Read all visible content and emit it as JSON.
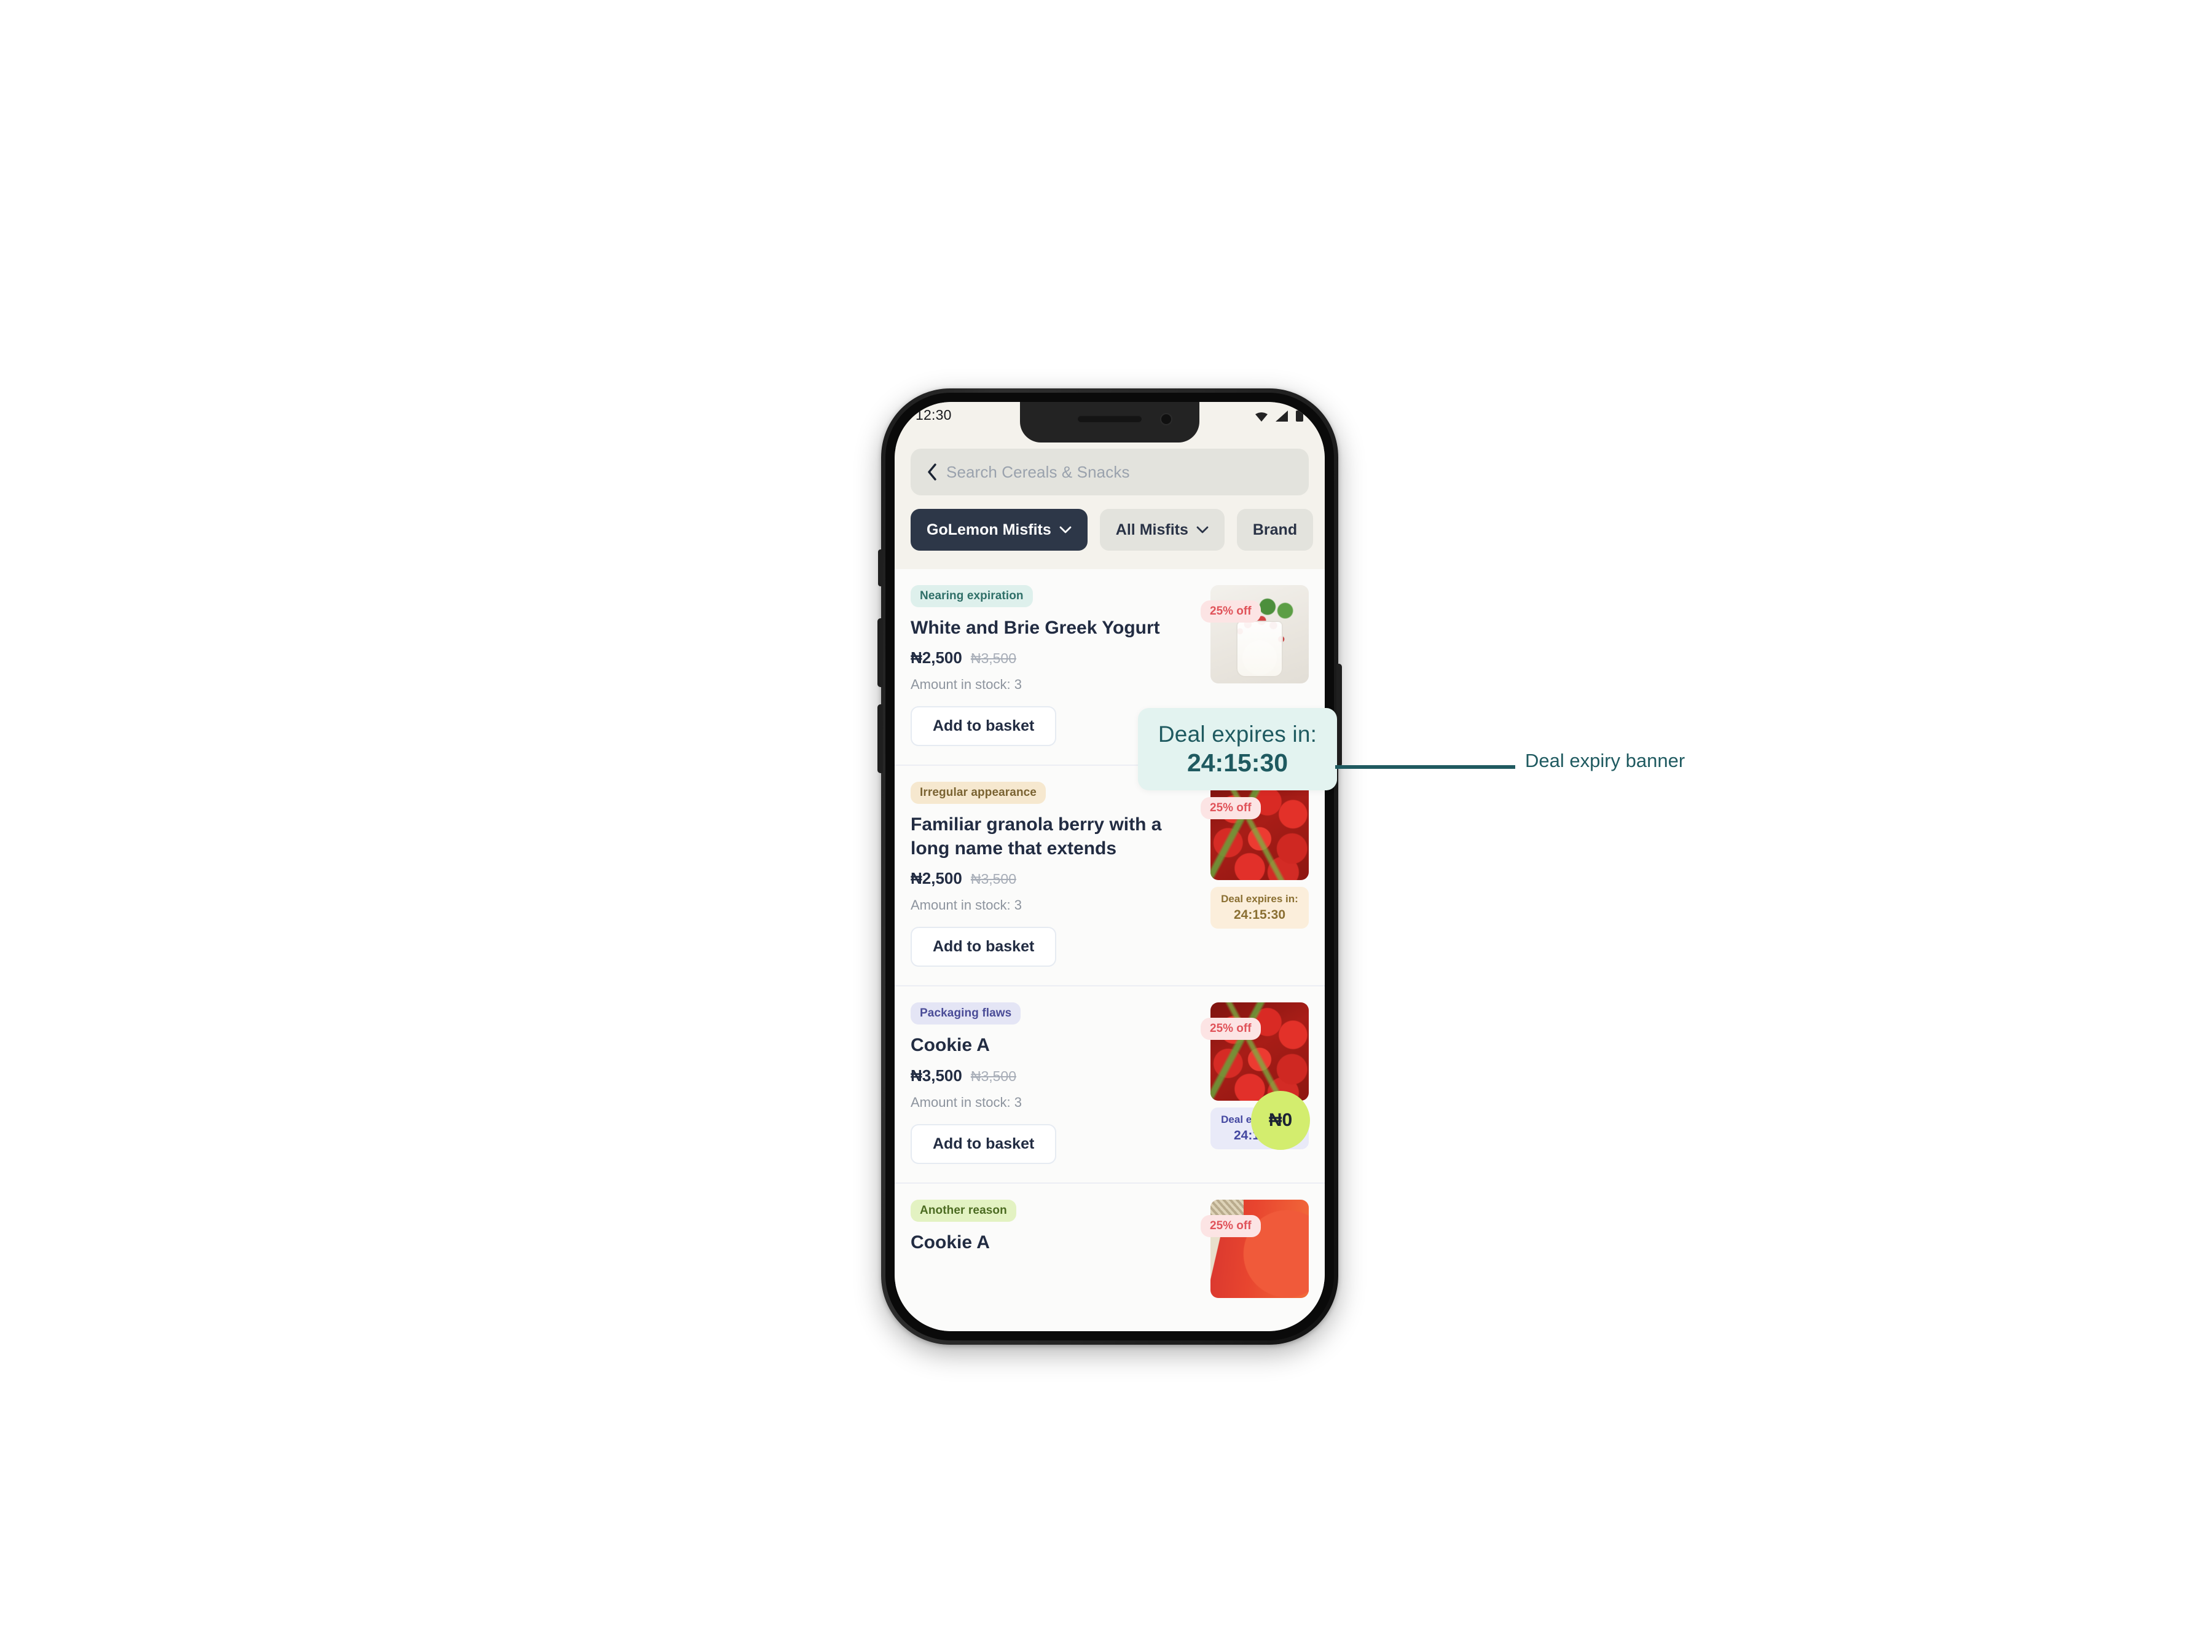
{
  "phone": {
    "status_bar": {
      "clock": "12:30",
      "icons": [
        "wifi-icon",
        "cellular-signal-icon",
        "battery-icon"
      ]
    }
  },
  "search": {
    "back_icon": "chevron-left-icon",
    "placeholder": "Search Cereals & Snacks",
    "value": ""
  },
  "filters": [
    {
      "label": "GoLemon Misfits",
      "active": true,
      "icon": "chevron-down-icon"
    },
    {
      "label": "All Misfits",
      "active": false,
      "icon": "chevron-down-icon"
    },
    {
      "label": "Brand",
      "active": false,
      "icon": "chevron-down-icon"
    }
  ],
  "products": [
    {
      "tag": "Nearing expiration",
      "tag_style": "mint",
      "name": "White and Brie Greek Yogurt",
      "price_now": "₦2,500",
      "price_old": "₦3,500",
      "stock": "Amount in stock: 3",
      "cta": "Add to basket",
      "discount": "25% off",
      "image": "yogurt-parfait-photo",
      "deal_label": "Deal expires in:",
      "deal_time": "24:15:30",
      "deal_style": "mint",
      "deal_hidden_by_callout": true
    },
    {
      "tag": "Irregular appearance",
      "tag_style": "peach",
      "name": "Familiar granola berry with a long name that extends",
      "price_now": "₦2,500",
      "price_old": "₦3,500",
      "stock": "Amount in stock: 3",
      "cta": "Add to basket",
      "discount": "25% off",
      "image": "cherry-tomatoes-photo",
      "deal_label": "Deal expires in:",
      "deal_time": "24:15:30",
      "deal_style": "peach",
      "deal_hidden_by_callout": false
    },
    {
      "tag": "Packaging flaws",
      "tag_style": "lav",
      "name": "Cookie A",
      "price_now": "₦3,500",
      "price_old": "₦3,500",
      "stock": "Amount in stock: 3",
      "cta": "Add to basket",
      "discount": "25% off",
      "image": "cherry-tomatoes-photo",
      "deal_label": "Deal expires in:",
      "deal_time": "24:15:30",
      "deal_style": "lav",
      "deal_hidden_by_callout": false,
      "free_badge": "₦0"
    },
    {
      "tag": "Another reason",
      "tag_style": "lime",
      "name": "Cookie A",
      "discount": "25% off",
      "image": "apple-photo",
      "clipped": true
    }
  ],
  "callout": {
    "label": "Deal expires in:",
    "time": "24:15:30",
    "annotation": "Deal expiry banner",
    "color": "#1f5a60",
    "background": "#e3f3f0"
  },
  "colors": {
    "page_background": "#ffffff",
    "screen_background": "#f4f2ec",
    "list_background": "#fbfbfa",
    "chip_active": "#2d3748",
    "chip_inactive": "#e3e3dd",
    "text_primary": "#222c42",
    "text_muted": "#8d949e",
    "discount_badge_bg": "#fce4e4",
    "discount_badge_fg": "#e0535a",
    "free_badge_bg": "#d3ed6e",
    "annotation": "#1f5a60"
  }
}
